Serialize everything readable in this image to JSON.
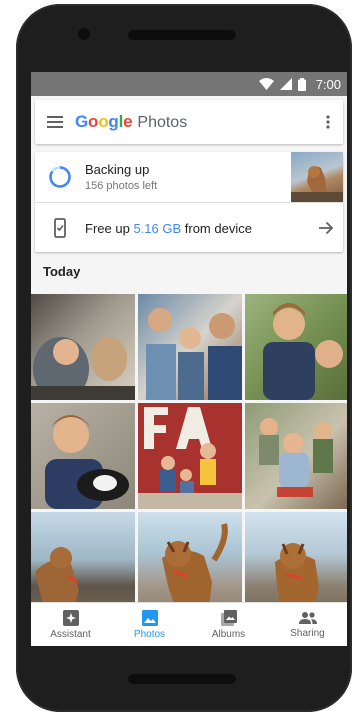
{
  "status": {
    "time": "7:00"
  },
  "appbar": {
    "logo_letters": [
      "G",
      "o",
      "o",
      "g",
      "l",
      "e"
    ],
    "logo_colors": [
      "#4285F4",
      "#EA4335",
      "#FBBC05",
      "#4285F4",
      "#34A853",
      "#EA4335"
    ],
    "product": "Photos"
  },
  "backup": {
    "title": "Backing up",
    "subtitle": "156 photos left"
  },
  "freeup": {
    "prefix": "Free up",
    "amount": "5.16 GB",
    "suffix": "from device"
  },
  "section": {
    "title": "Today"
  },
  "nav": [
    {
      "label": "Assistant",
      "icon": "assistant-icon",
      "active": false
    },
    {
      "label": "Photos",
      "icon": "photos-icon",
      "active": true
    },
    {
      "label": "Albums",
      "icon": "albums-icon",
      "active": false
    },
    {
      "label": "Sharing",
      "icon": "sharing-icon",
      "active": false
    }
  ],
  "colors": {
    "accent": "#2196F3",
    "status_bar": "#757575",
    "link": "#4285F4"
  }
}
